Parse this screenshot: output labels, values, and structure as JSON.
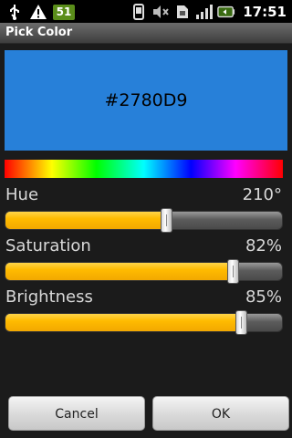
{
  "status_bar": {
    "badge": "51",
    "time": "17:51",
    "icons": [
      "usb-icon",
      "warning-icon",
      "notification-count-badge",
      "phone-icon",
      "vibrate-mute-icon",
      "sim-icon",
      "signal-icon",
      "battery-icon"
    ]
  },
  "dialog": {
    "title": "Pick Color"
  },
  "color": {
    "hex_label": "#2780D9",
    "swatch_color": "#2780D9"
  },
  "spectrum": {
    "colors": [
      "#ff0000",
      "#ffff00",
      "#00ff00",
      "#00ffff",
      "#0000ff",
      "#ff00ff",
      "#ff0000"
    ]
  },
  "sliders": {
    "hue": {
      "label": "Hue",
      "value_text": "210°",
      "fraction": 0.58
    },
    "saturation": {
      "label": "Saturation",
      "value_text": "82%",
      "fraction": 0.82
    },
    "brightness": {
      "label": "Brightness",
      "value_text": "85%",
      "fraction": 0.85
    }
  },
  "buttons": {
    "cancel": "Cancel",
    "ok": "OK"
  },
  "theme": {
    "accent": "#FFBB00",
    "background": "#1B1B1B",
    "status_badge": "#5A8D1A"
  }
}
